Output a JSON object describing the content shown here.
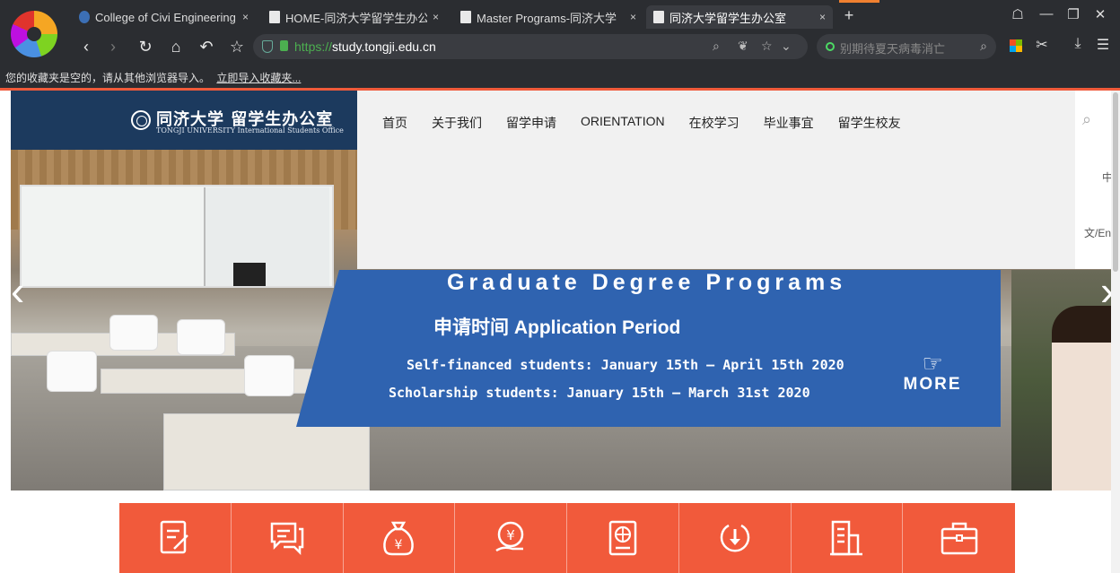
{
  "browser": {
    "tabs": [
      {
        "label": "College of Civi Engineering",
        "close": "×",
        "active": false
      },
      {
        "label": "HOME-同济大学留学生办公室",
        "close": "×",
        "active": false
      },
      {
        "label": "Master Programs-同济大学",
        "close": "×",
        "active": false
      },
      {
        "label": "同济大学留学生办公室",
        "close": "×",
        "active": true
      }
    ],
    "new_tab": "+",
    "url_protocol": "https://",
    "url_host": "study.tongji.edu.cn",
    "search_placeholder": "别期待夏天病毒消亡",
    "bookmark_text": "您的收藏夹是空的，请从其他浏览器导入。",
    "bookmark_link": "立即导入收藏夹..."
  },
  "site": {
    "logo_cn": "同济大学 留学生办公室",
    "logo_en": "TONGJI UNIVERSITY   International Students Office",
    "nav": [
      "首页",
      "关于我们",
      "留学申请",
      "ORIENTATION",
      "在校学习",
      "毕业事宜",
      "留学生校友"
    ],
    "lang_cn": "中",
    "lang_en": "文/Eng"
  },
  "banner": {
    "title": "Graduate Degree Programs",
    "subtitle": "申请时间 Application Period",
    "line1": "Self-financed students: January 15th – April 15th 2020",
    "line2": "Scholarship students: January 15th – March 31st 2020",
    "more": "MORE"
  },
  "quick_icons": [
    "form-icon",
    "chat-icon",
    "scholarship-bag-icon",
    "payment-icon",
    "passport-icon",
    "download-icon",
    "building-icon",
    "briefcase-icon"
  ],
  "colors": {
    "accent": "#f15a3b",
    "banner_blue": "#2f63b0",
    "logo_bg": "#1c3a5e"
  }
}
